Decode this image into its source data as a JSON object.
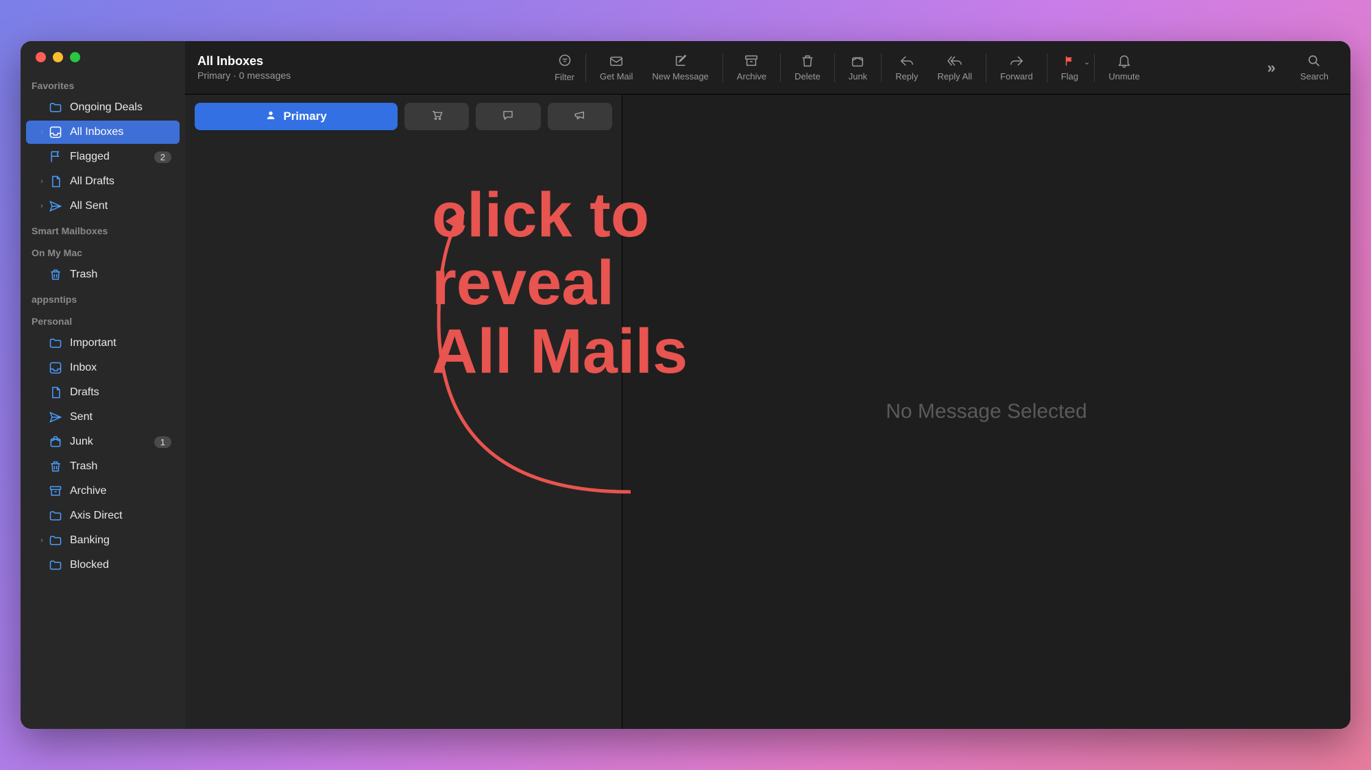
{
  "window": {
    "title": "All Inboxes",
    "subtitle": "Primary · 0 messages"
  },
  "toolbar": {
    "filter": "Filter",
    "get_mail": "Get Mail",
    "new_message": "New Message",
    "archive": "Archive",
    "delete": "Delete",
    "junk": "Junk",
    "reply": "Reply",
    "reply_all": "Reply All",
    "forward": "Forward",
    "flag": "Flag",
    "unmute": "Unmute",
    "search": "Search"
  },
  "categories": {
    "primary": "Primary"
  },
  "sidebar": {
    "sections": {
      "favorites": "Favorites",
      "smart": "Smart Mailboxes",
      "onmymac": "On My Mac",
      "appsntips": "appsntips",
      "personal": "Personal"
    },
    "favorites": [
      {
        "label": "Ongoing Deals",
        "icon": "folder"
      },
      {
        "label": "All Inboxes",
        "icon": "tray",
        "active": true,
        "hasChevron": true
      },
      {
        "label": "Flagged",
        "icon": "flag",
        "badge": "2"
      },
      {
        "label": "All Drafts",
        "icon": "doc",
        "hasChevron": true
      },
      {
        "label": "All Sent",
        "icon": "send",
        "hasChevron": true
      }
    ],
    "onmymac": [
      {
        "label": "Trash",
        "icon": "trash"
      }
    ],
    "personal": [
      {
        "label": "Important",
        "icon": "folder"
      },
      {
        "label": "Inbox",
        "icon": "tray"
      },
      {
        "label": "Drafts",
        "icon": "doc"
      },
      {
        "label": "Sent",
        "icon": "send"
      },
      {
        "label": "Junk",
        "icon": "junk",
        "badge": "1"
      },
      {
        "label": "Trash",
        "icon": "trash"
      },
      {
        "label": "Archive",
        "icon": "archive"
      },
      {
        "label": "Axis Direct",
        "icon": "folder"
      },
      {
        "label": "Banking",
        "icon": "folder",
        "hasChevron": true
      },
      {
        "label": "Blocked",
        "icon": "folder"
      }
    ]
  },
  "viewer": {
    "empty": "No Message Selected"
  },
  "annotation": {
    "line1": "click to",
    "line2": "reveal",
    "line3": "All Mails"
  }
}
